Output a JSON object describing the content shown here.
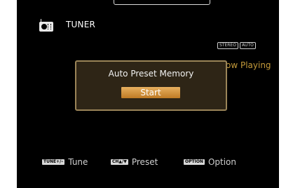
{
  "header": {
    "source_icon": "radio-tuner-icon",
    "source_name": "TUNER"
  },
  "indicators": [
    "STEREO",
    "AUTO"
  ],
  "background_text": "ow Playing",
  "dialog": {
    "title": "Auto Preset Memory",
    "start_label": "Start"
  },
  "hints": [
    {
      "key": "TUNE+/–",
      "label": "Tune"
    },
    {
      "key": "CH▲/▼",
      "label": "Preset"
    },
    {
      "key": "OPTION",
      "label": "Option"
    }
  ],
  "colors": {
    "screen_bg": "#000000",
    "accent_text": "#c49a3a",
    "dialog_bg": "#2e2516",
    "dialog_border": "#9a8458",
    "button": "#d99a48"
  }
}
